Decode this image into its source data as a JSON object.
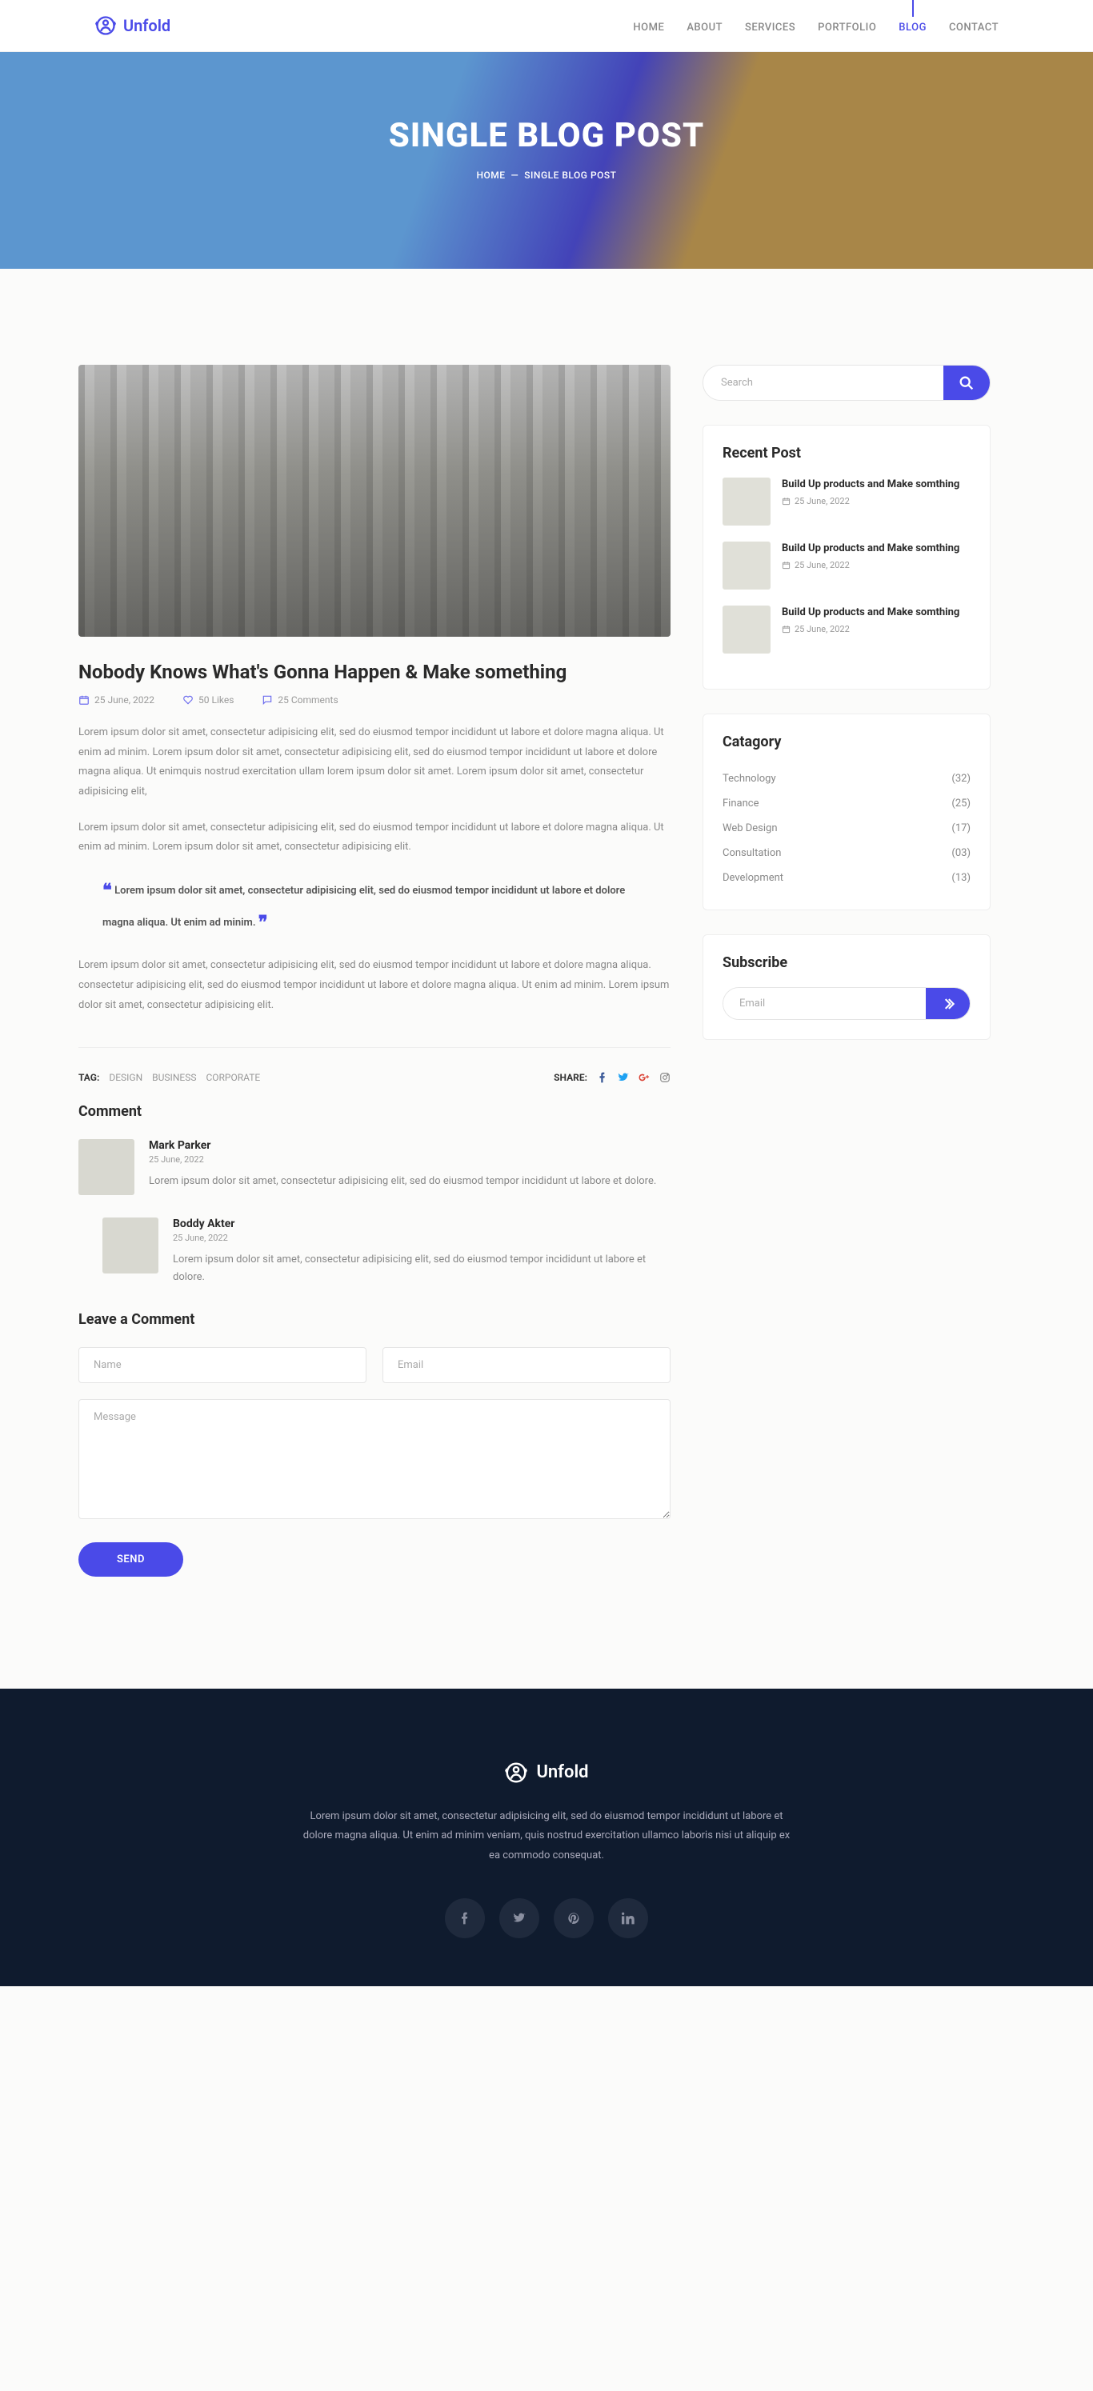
{
  "brand": "Unfold",
  "nav": [
    "HOME",
    "ABOUT",
    "SERVICES",
    "PORTFOLIO",
    "BLOG",
    "CONTACT"
  ],
  "nav_active": 4,
  "hero": {
    "title": "SINGLE BLOG POST",
    "crumb_home": "HOME",
    "crumb_sep": "—",
    "crumb_current": "SINGLE BLOG POST"
  },
  "post": {
    "title": "Nobody Knows What's Gonna Happen & Make something",
    "date": "25 June, 2022",
    "likes": "50 Likes",
    "comments": "25 Comments",
    "para1": "Lorem ipsum dolor sit amet, consectetur adipisicing elit, sed do eiusmod tempor incididunt ut labore et dolore magna aliqua. Ut enim ad minim. Lorem ipsum dolor sit amet, consectetur adipisicing elit, sed do eiusmod tempor incididunt ut labore et dolore magna aliqua. Ut enimquis nostrud exercitation ullam lorem ipsum dolor sit amet. Lorem ipsum dolor sit amet, consectetur adipisicing elit,",
    "para2": "Lorem ipsum dolor sit amet, consectetur adipisicing elit, sed do eiusmod tempor incididunt ut labore et dolore magna aliqua. Ut enim ad minim. Lorem ipsum dolor sit amet, consectetur adipisicing elit.",
    "quote": "Lorem ipsum dolor sit amet, consectetur adipisicing elit, sed do eiusmod tempor incididunt ut labore et dolore magna aliqua. Ut enim ad minim.",
    "para3": "Lorem ipsum dolor sit amet, consectetur adipisicing elit, sed do eiusmod tempor incididunt ut labore et dolore magna aliqua. consectetur adipisicing elit, sed do eiusmod tempor incididunt ut labore et dolore magna aliqua. Ut enim ad minim. Lorem ipsum dolor sit amet, consectetur adipisicing elit."
  },
  "tags": {
    "label": "TAG:",
    "items": [
      "DESIGN",
      "BUSINESS",
      "CORPORATE"
    ]
  },
  "share_label": "SHARE:",
  "comment_heading": "Comment",
  "comments": [
    {
      "name": "Mark Parker",
      "date": "25 June, 2022",
      "text": "Lorem ipsum dolor sit amet, consectetur adipisicing elit, sed do eiusmod tempor incididunt ut labore et dolore."
    },
    {
      "name": "Boddy Akter",
      "date": "25 June, 2022",
      "text": "Lorem ipsum dolor sit amet, consectetur adipisicing elit, sed do eiusmod tempor incididunt ut labore et dolore."
    }
  ],
  "leave_heading": "Leave a Comment",
  "form": {
    "name": "Name",
    "email": "Email",
    "message": "Message",
    "send": "SEND"
  },
  "sidebar": {
    "search_ph": "Search",
    "recent_title": "Recent Post",
    "recent": [
      {
        "title": "Build Up products and Make somthing",
        "date": "25 June, 2022"
      },
      {
        "title": "Build Up products and Make somthing",
        "date": "25 June, 2022"
      },
      {
        "title": "Build Up products and Make somthing",
        "date": "25 June, 2022"
      }
    ],
    "cat_title": "Catagory",
    "cats": [
      {
        "name": "Technology",
        "count": "(32)"
      },
      {
        "name": "Finance",
        "count": "(25)"
      },
      {
        "name": "Web Design",
        "count": "(17)"
      },
      {
        "name": "Consultation",
        "count": "(03)"
      },
      {
        "name": "Development",
        "count": "(13)"
      }
    ],
    "sub_title": "Subscribe",
    "sub_ph": "Email"
  },
  "footer": {
    "text": "Lorem ipsum dolor sit amet, consectetur adipisicing elit, sed do eiusmod tempor incididunt ut labore et dolore magna aliqua. Ut enim ad minim veniam, quis nostrud exercitation ullamco laboris nisi ut aliquip ex ea commodo consequat."
  }
}
